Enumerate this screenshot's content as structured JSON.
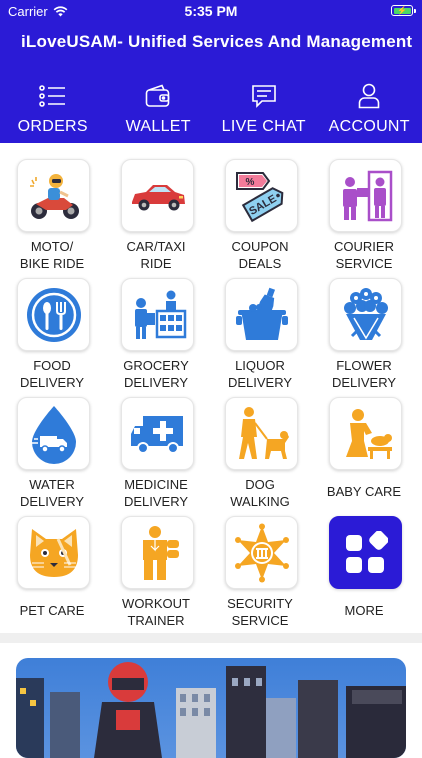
{
  "status_bar": {
    "carrier": "Carrier",
    "time": "5:35 PM"
  },
  "app_title": "iLoveUSAM- Unified Services And Management",
  "nav": [
    {
      "label": "ORDERS",
      "icon": "orders-list-icon"
    },
    {
      "label": "WALLET",
      "icon": "wallet-icon"
    },
    {
      "label": "LIVE CHAT",
      "icon": "chat-icon"
    },
    {
      "label": "ACCOUNT",
      "icon": "user-icon"
    }
  ],
  "services": [
    {
      "line1": "MOTO/",
      "line2": "BIKE RIDE",
      "icon": "motorbike-rider-icon"
    },
    {
      "line1": "CAR/TAXI",
      "line2": "RIDE",
      "icon": "car-icon"
    },
    {
      "line1": "COUPON",
      "line2": "DEALS",
      "icon": "sale-tag-icon"
    },
    {
      "line1": "COURIER",
      "line2": "SERVICE",
      "icon": "courier-icon"
    },
    {
      "line1": "FOOD",
      "line2": "DELIVERY",
      "icon": "plate-fork-spoon-icon"
    },
    {
      "line1": "GROCERY",
      "line2": "DELIVERY",
      "icon": "grocery-store-icon"
    },
    {
      "line1": "LIQUOR",
      "line2": "DELIVERY",
      "icon": "ice-bucket-bottle-icon"
    },
    {
      "line1": "FLOWER",
      "line2": "DELIVERY",
      "icon": "flower-bouquet-icon"
    },
    {
      "line1": "WATER",
      "line2": "DELIVERY",
      "icon": "water-drop-truck-icon"
    },
    {
      "line1": "MEDICINE",
      "line2": "DELIVERY",
      "icon": "ambulance-icon"
    },
    {
      "line1": "DOG",
      "line2": "WALKING",
      "icon": "dog-walking-icon"
    },
    {
      "line1": "BABY CARE",
      "line2": "",
      "icon": "baby-care-icon"
    },
    {
      "line1": "PET CARE",
      "line2": "",
      "icon": "cat-face-icon"
    },
    {
      "line1": "WORKOUT",
      "line2": "TRAINER",
      "icon": "trainer-icon"
    },
    {
      "line1": "SECURITY",
      "line2": "SERVICE",
      "icon": "sheriff-badge-icon"
    },
    {
      "line1": "MORE",
      "line2": "",
      "icon": "more-apps-icon"
    }
  ],
  "colors": {
    "header": "#2b1bd6",
    "icon_blue": "#2f7bd9",
    "icon_orange": "#f5a623",
    "icon_purple": "#a94fc9",
    "more_tile": "#2b1bd6"
  }
}
